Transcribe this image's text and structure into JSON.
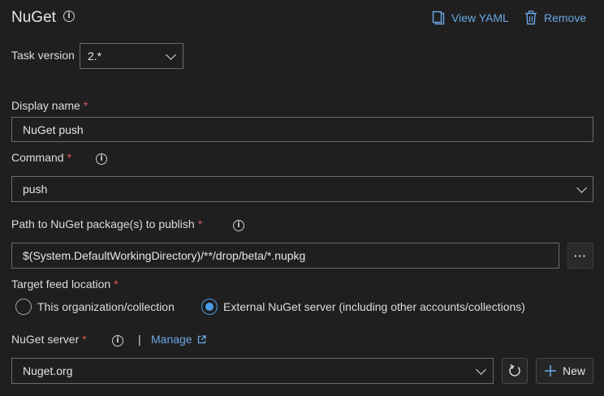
{
  "header": {
    "title": "NuGet",
    "view_yaml": "View YAML",
    "remove": "Remove"
  },
  "task_version": {
    "label": "Task version",
    "value": "2.*"
  },
  "display_name": {
    "label": "Display name",
    "required": "*",
    "value": "NuGet push"
  },
  "command": {
    "label": "Command",
    "required": "*",
    "value": "push"
  },
  "path": {
    "label": "Path to NuGet package(s) to publish",
    "required": "*",
    "value": "$(System.DefaultWorkingDirectory)/**/drop/beta/*.nupkg",
    "browse": "···"
  },
  "target_feed": {
    "label": "Target feed location",
    "required": "*",
    "options": [
      "This organization/collection",
      "External NuGet server (including other accounts/collections)"
    ],
    "selected_index": 1
  },
  "nuget_server": {
    "label": "NuGet server",
    "required": "*",
    "separator": "|",
    "manage": "Manage",
    "value": "Nuget.org",
    "new_label": "New"
  }
}
